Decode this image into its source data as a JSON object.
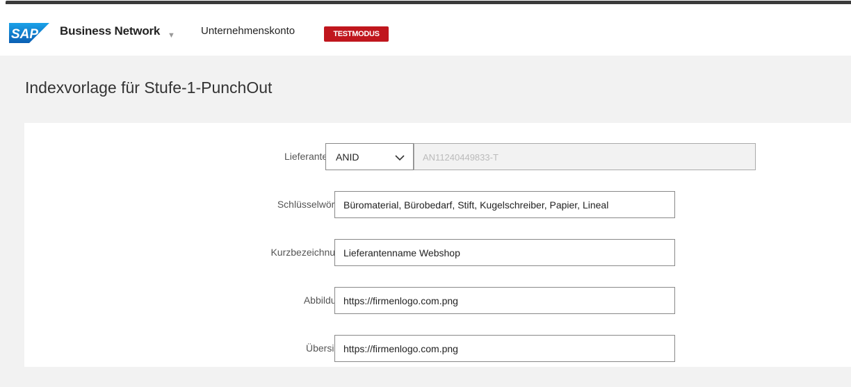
{
  "header": {
    "logo_text": "SAP",
    "brand": "Business Network",
    "brand_caret": "▼",
    "account": "Unternehmenskonto",
    "badge": "TESTMODUS"
  },
  "page": {
    "title": "Indexvorlage für Stufe-1-PunchOut"
  },
  "form": {
    "required_marker": "*",
    "supplier_id": {
      "label": "Lieferanten-ID:",
      "type_value": "ANID",
      "id_value": "AN11240449833-T"
    },
    "keywords": {
      "label": "Schlüsselwörter:",
      "value": "Büromaterial, Bürobedarf, Stift, Kugelschreiber, Papier, Lineal"
    },
    "short_name": {
      "label": "Kurzbezeichnung:",
      "value": "Lieferantenname Webshop"
    },
    "image": {
      "label": "Abbildung:",
      "value": "https://firmenlogo.com.png"
    },
    "overview": {
      "label": "Übersicht:",
      "value": "https://firmenlogo.com.png"
    }
  },
  "colors": {
    "brand_blue": "#0a6ed1",
    "badge_red": "#c0161d",
    "required_red": "#b0164d"
  }
}
